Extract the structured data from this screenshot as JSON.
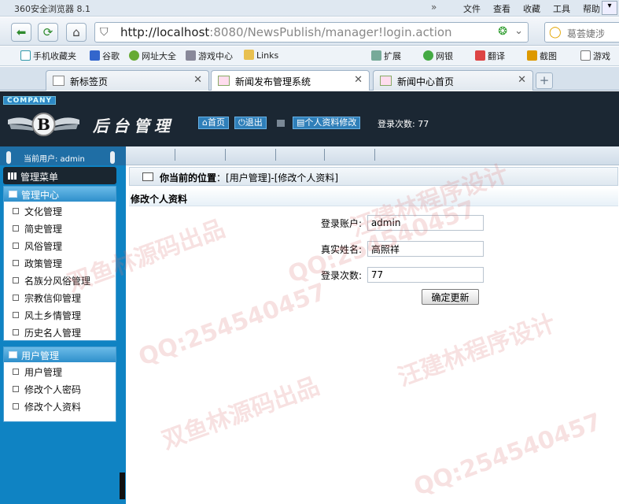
{
  "browser": {
    "app_title": "360安全浏览器 8.1",
    "menu": [
      "文件",
      "查看",
      "收藏",
      "工具",
      "帮助"
    ],
    "url_host": "http://localhost",
    "url_rest": ":8080/NewsPublish/manager!login.action",
    "search_placeholder": "葛荟婕涉",
    "favorites": [
      "手机收藏夹",
      "谷歌",
      "网址大全",
      "游戏中心",
      "Links",
      "扩展",
      "网银",
      "翻译",
      "截图",
      "游戏"
    ],
    "tabs": [
      {
        "label": "新标签页",
        "active": false
      },
      {
        "label": "新闻发布管理系统",
        "active": true
      },
      {
        "label": "新闻中心首页",
        "active": false
      }
    ]
  },
  "header": {
    "company": "COMPANY",
    "title": "后台管理",
    "home_label": "首页",
    "logout_label": "退出",
    "profile_label": "个人资料修改",
    "login_count_text": "登录次数: 77"
  },
  "sidebar": {
    "current_user": "当前用户: admin",
    "menu_title": "管理菜单",
    "groups": [
      {
        "title": "管理中心",
        "items": [
          "文化管理",
          "简史管理",
          "风俗管理",
          "政策管理",
          "名族分风俗管理",
          "宗教信仰管理",
          "风土乡情管理",
          "历史名人管理"
        ]
      },
      {
        "title": "用户管理",
        "items": [
          "用户管理",
          "修改个人密码",
          "修改个人资料"
        ]
      }
    ]
  },
  "main": {
    "breadcrumb_label": "你当前的位置",
    "breadcrumb_path": "：[用户管理]-[修改个人资料]",
    "section_title": "修改个人资料",
    "form": {
      "account_label": "登录账户:",
      "account_value": "admin",
      "name_label": "真实姓名:",
      "name_value": "高照祥",
      "count_label": "登录次数:",
      "count_value": "77",
      "submit_label": "确定更新"
    }
  },
  "watermarks": [
    "双鱼林源码出品",
    "QQ:254540457",
    "汪建林程序设计"
  ]
}
